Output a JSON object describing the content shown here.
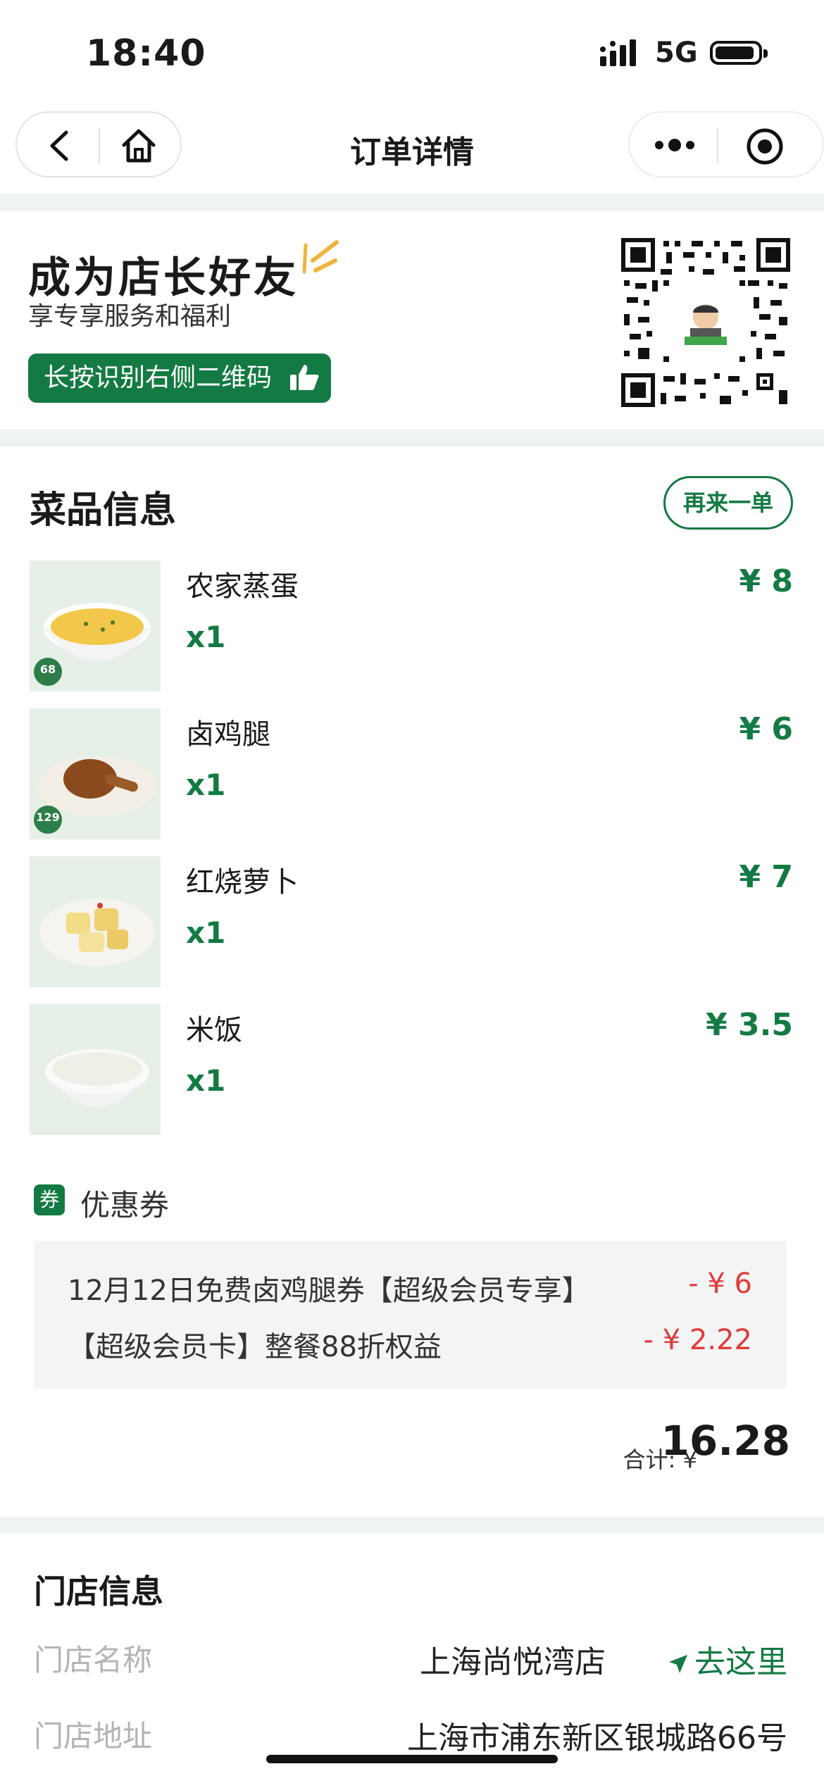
{
  "status_bar": {
    "time": "18:40",
    "network": "5G"
  },
  "nav": {
    "title": "订单详情"
  },
  "promo": {
    "title": "成为店长好友",
    "subtitle": "享专享服务和福利",
    "button_label": "长按识别右侧二维码"
  },
  "dishes": {
    "section_title": "菜品信息",
    "reorder_label": "再来一单",
    "items": [
      {
        "name": "农家蒸蛋",
        "qty": "x1",
        "price": "¥ 8",
        "kcal": "68"
      },
      {
        "name": "卤鸡腿",
        "qty": "x1",
        "price": "¥ 6",
        "kcal": "129"
      },
      {
        "name": "红烧萝卜",
        "qty": "x1",
        "price": "¥ 7"
      },
      {
        "name": "米饭",
        "qty": "x1",
        "price": "¥ 3.5"
      }
    ]
  },
  "coupons": {
    "badge": "券",
    "label": "优惠券",
    "items": [
      {
        "name": "12月12日免费卤鸡腿券【超级会员专享】",
        "amount": "- ¥ 6"
      },
      {
        "name": "【超级会员卡】整餐88折权益",
        "amount": "- ¥ 2.22"
      }
    ]
  },
  "total": {
    "label": "合计: ¥",
    "value": "16.28"
  },
  "store": {
    "section_title": "门店信息",
    "name_label": "门店名称",
    "name_value": "上海尚悦湾店",
    "navigate_label": "去这里",
    "address_label": "门店地址",
    "address_value": "上海市浦东新区银城路66号"
  },
  "colors": {
    "brand_green": "#137a43",
    "discount_red": "#e03a3a"
  }
}
